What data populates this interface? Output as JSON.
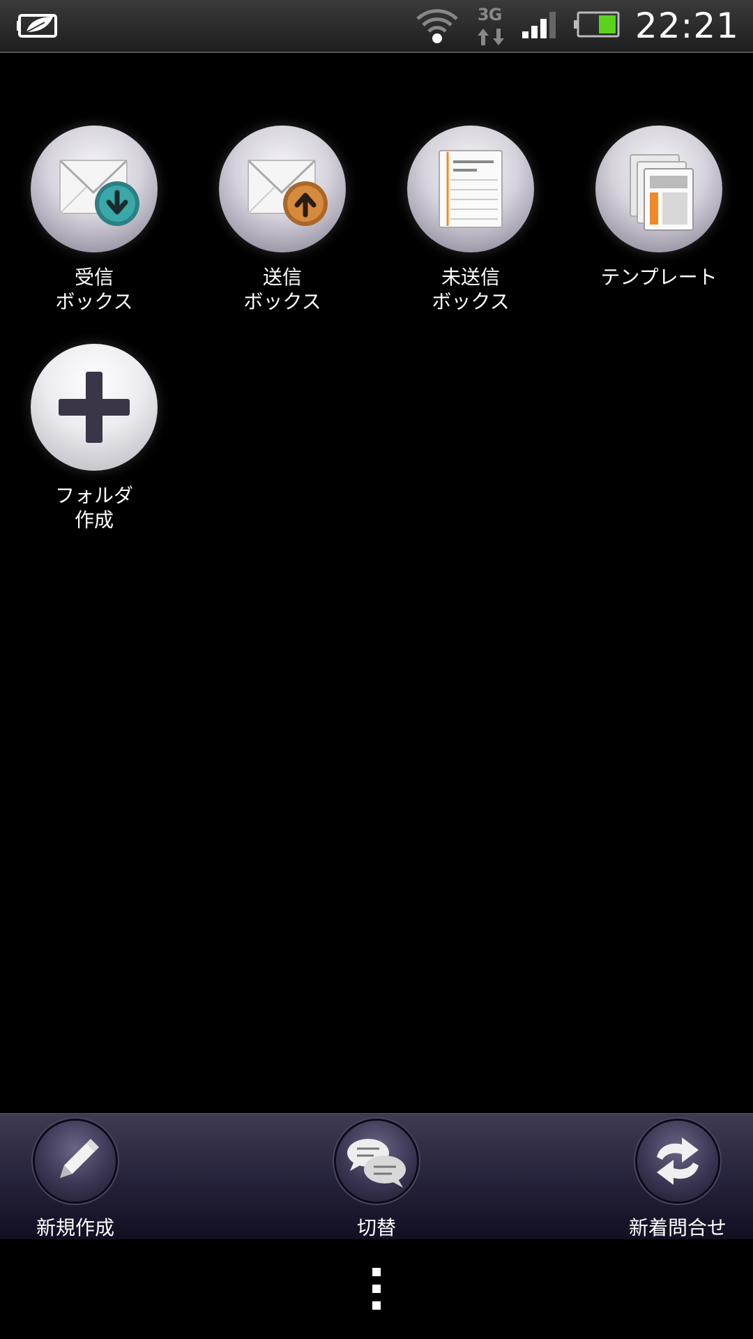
{
  "status_bar": {
    "time": "22:21",
    "network_type": "3G",
    "icons": [
      "leaf-battery-saver-icon",
      "wifi-icon",
      "3g-data-icon",
      "signal-icon",
      "battery-icon"
    ],
    "battery_color": "#5bd21e"
  },
  "folders": [
    {
      "label": "受信\nボックス",
      "icon": "inbox-envelope-icon",
      "accent": "#3aa7a8"
    },
    {
      "label": "送信\nボックス",
      "icon": "outbox-envelope-icon",
      "accent": "#d68a3c"
    },
    {
      "label": "未送信\nボックス",
      "icon": "unsent-document-icon",
      "accent": "#f08a24"
    },
    {
      "label": "テンプレート",
      "icon": "template-icon",
      "accent": "#f08a24"
    },
    {
      "label": "フォルダ\n作成",
      "icon": "plus-icon",
      "accent": "#3a3548"
    }
  ],
  "action_bar": {
    "new": {
      "label": "新規作成",
      "icon": "pencil-icon"
    },
    "switch": {
      "label": "切替",
      "icon": "chat-bubbles-icon"
    },
    "check": {
      "label": "新着問合せ",
      "icon": "refresh-icon"
    }
  },
  "overflow_icon": "overflow-menu-icon"
}
